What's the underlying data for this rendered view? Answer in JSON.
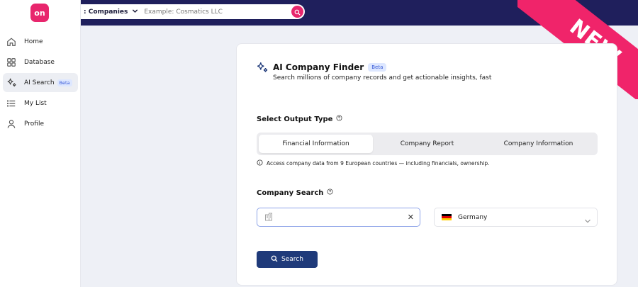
{
  "brand": {
    "logo_text": "on",
    "accent": "#e8266d",
    "nav_dark": "#1f1f5c"
  },
  "sidebar": {
    "items": [
      {
        "label": "Home",
        "icon": "home-icon"
      },
      {
        "label": "Database",
        "icon": "grid-icon"
      },
      {
        "label": "AI Search",
        "icon": "sparkle-icon",
        "badge": "Beta",
        "active": true
      },
      {
        "label": "My List",
        "icon": "list-icon"
      },
      {
        "label": "Profile",
        "icon": "user-icon"
      }
    ]
  },
  "topbar": {
    "scope_label": ": Companies",
    "search_placeholder": "Example: Cosmatics LLC"
  },
  "ribbon": {
    "text": "NEW"
  },
  "card": {
    "title": "AI Company Finder",
    "title_badge": "Beta",
    "subtitle": "Search millions of company records and get actionable insights, fast",
    "output_type": {
      "heading": "Select Output Type",
      "options": [
        "Financial Information",
        "Company Report",
        "Company Information"
      ],
      "selected": "Financial Information",
      "note": "Access company data from 9 European countries — including financials, ownership."
    },
    "company_search": {
      "heading": "Company Search",
      "input_value": "",
      "country": "Germany"
    },
    "search_button": "Search"
  }
}
